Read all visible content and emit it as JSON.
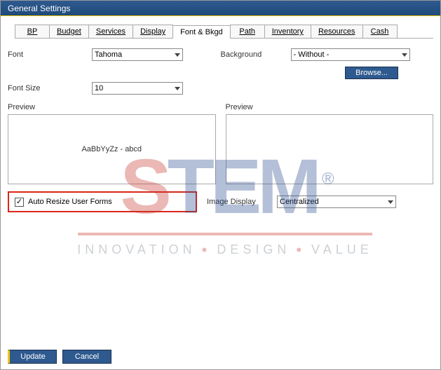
{
  "title": "General Settings",
  "tabs": [
    "BP",
    "Budget",
    "Services",
    "Display",
    "Font & Bkgd",
    "Path",
    "Inventory",
    "Resources",
    "Cash"
  ],
  "active_tab_index": 4,
  "font": {
    "label": "Font",
    "value": "Tahoma"
  },
  "background": {
    "label": "Background",
    "value": "- Without -"
  },
  "font_size": {
    "label": "Font Size",
    "value": "10"
  },
  "browse_label": "Browse...",
  "preview_label_left": "Preview",
  "preview_label_right": "Preview",
  "preview_sample": "AaBbYyZz - abcd",
  "auto_resize": {
    "label": "Auto Resize User Forms",
    "checked": true
  },
  "image_display": {
    "label": "Image Display",
    "value": "Centralized"
  },
  "buttons": {
    "update": "Update",
    "cancel": "Cancel"
  },
  "watermark": {
    "s": "S",
    "tem": "TEM",
    "reg": "®",
    "tag1": "INNOVATION",
    "tag2": "DESIGN",
    "tag3": "VALUE"
  }
}
